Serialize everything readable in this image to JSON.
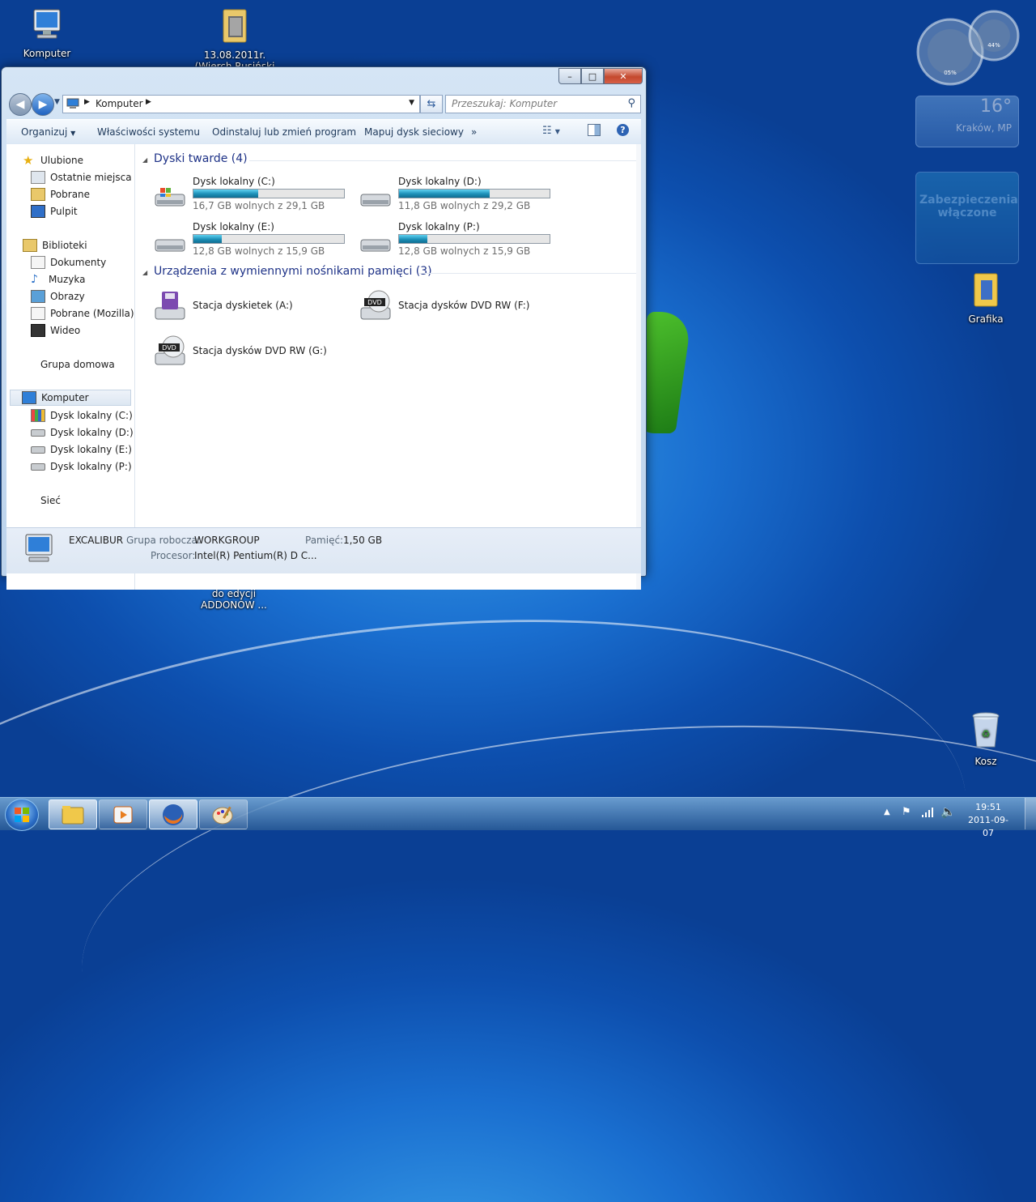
{
  "desktop": {
    "icons": [
      {
        "label": "Komputer"
      },
      {
        "label": "13.08.2011r.(Wierch Rusiński 59 - Bialk"
      },
      {
        "label": "Grafika"
      },
      {
        "label": "Kosz"
      },
      {
        "label": "Oprogramowanie do edycji ADDONÓW ..."
      }
    ],
    "gadgets": {
      "meter_cpu": "05%",
      "meter_mem": "44%",
      "weather_temp": "16°",
      "weather_city": "Kraków, MP",
      "security_text": "Zabezpieczenia włączone"
    }
  },
  "window": {
    "buttons": {
      "minimize": "–",
      "maximize": "□",
      "close": "✕"
    },
    "address": {
      "crumb": "Komputer"
    },
    "search_placeholder": "Przeszukaj: Komputer",
    "commands": [
      "Organizuj",
      "Właściwości systemu",
      "Odinstaluj lub zmień program",
      "Mapuj dysk sieciowy",
      "»"
    ],
    "nav": {
      "favorites": [
        "Ulubione",
        "Ostatnie miejsca",
        "Pobrane",
        "Pulpit"
      ],
      "libraries": [
        "Biblioteki",
        "Dokumenty",
        "Muzyka",
        "Obrazy",
        "Pobrane (Mozilla)",
        "Wideo"
      ],
      "homegroup": "Grupa domowa",
      "computer": [
        "Komputer",
        "Dysk lokalny (C:)",
        "Dysk lokalny (D:)",
        "Dysk lokalny (E:)",
        "Dysk lokalny (P:)"
      ],
      "network": "Sieć"
    },
    "groups": {
      "hard_drives": "Dyski twarde (4)",
      "removable": "Urządzenia z wymiennymi nośnikami pamięci (3)"
    },
    "drives": [
      {
        "name": "Dysk lokalny (C:)",
        "free": "16,7 GB wolnych z 29,1 GB",
        "used_fraction": 0.43
      },
      {
        "name": "Dysk lokalny (D:)",
        "free": "11,8 GB wolnych z 29,2 GB",
        "used_fraction": 0.6
      },
      {
        "name": "Dysk lokalny (E:)",
        "free": "12,8 GB wolnych z 15,9 GB",
        "used_fraction": 0.19
      },
      {
        "name": "Dysk lokalny (P:)",
        "free": "12,8 GB wolnych z 15,9 GB",
        "used_fraction": 0.19
      }
    ],
    "removable": [
      {
        "name": "Stacja dyskietek (A:)"
      },
      {
        "name": "Stacja dysków DVD RW (F:)",
        "badge": "DVD"
      },
      {
        "name": "Stacja dysków DVD RW (G:)",
        "badge": "DVD"
      }
    ],
    "details": {
      "computer_name": "EXCALIBUR",
      "workgroup_label": "Grupa robocza:",
      "workgroup_value": "WORKGROUP",
      "memory_label": "Pamięć:",
      "memory_value": "1,50 GB",
      "cpu_label": "Procesor:",
      "cpu_value": "Intel(R) Pentium(R) D  C..."
    }
  },
  "taskbar": {
    "time": "19:51",
    "date": "2011-09-07"
  }
}
